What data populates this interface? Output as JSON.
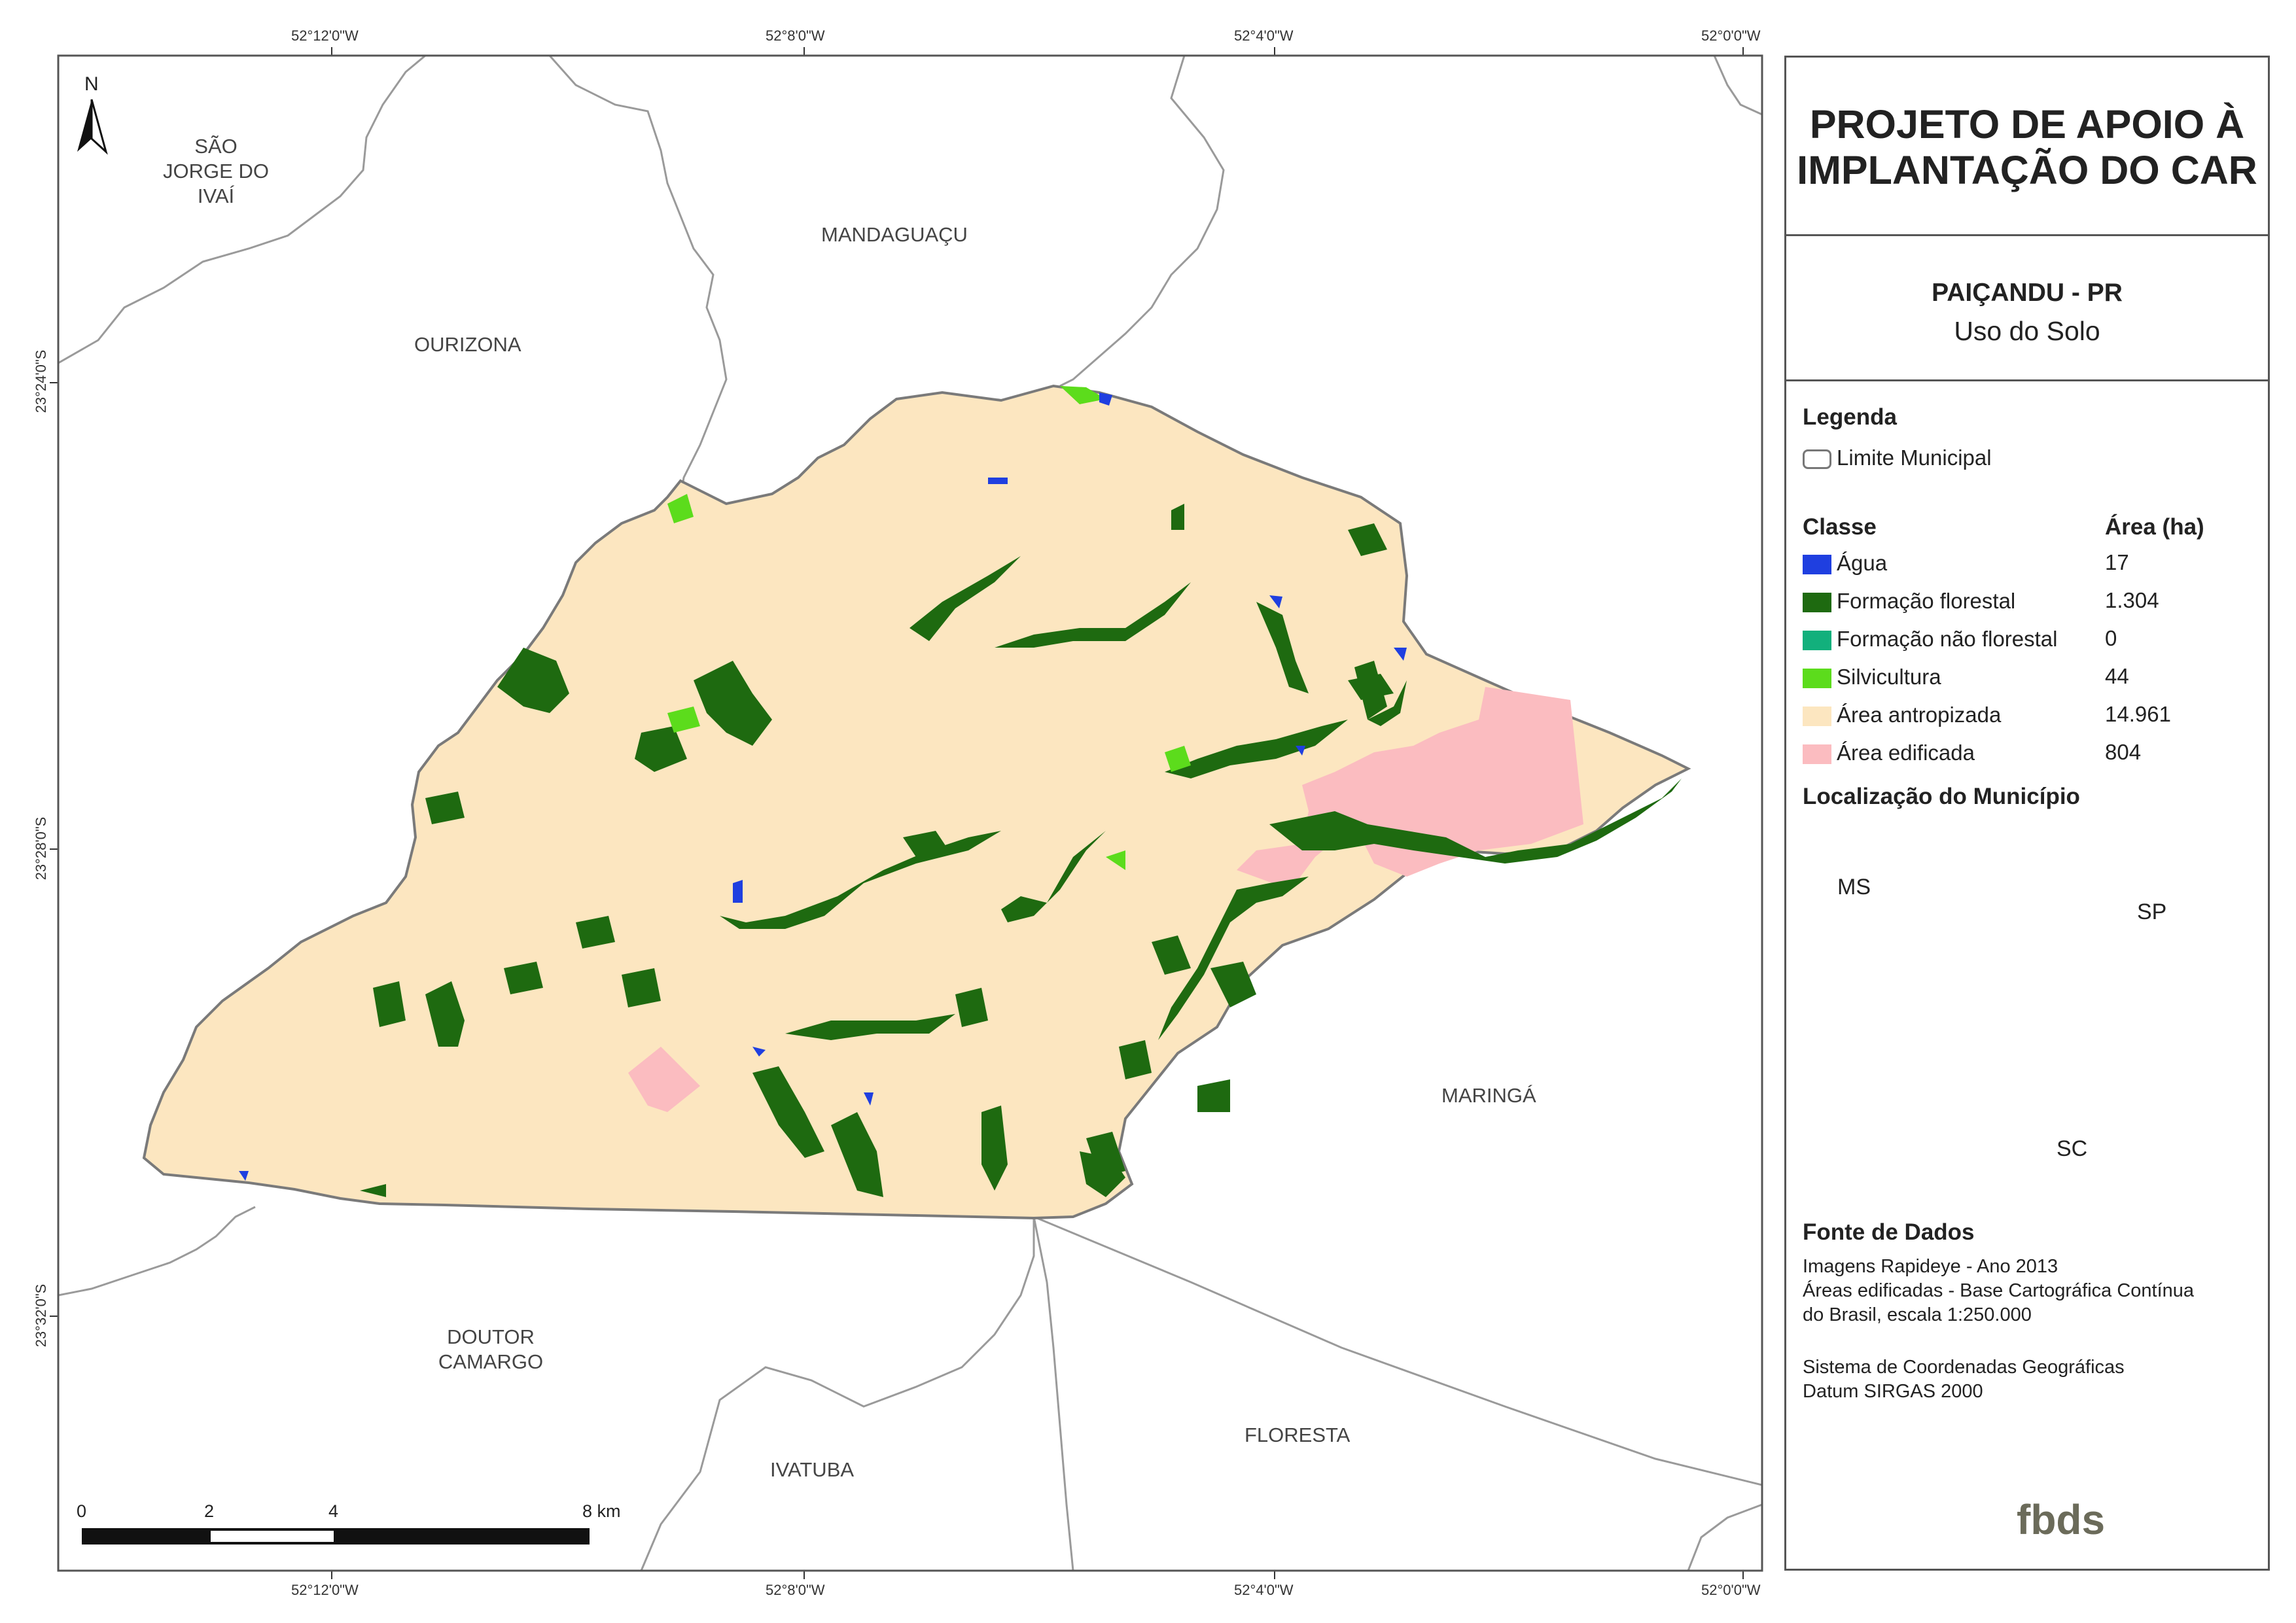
{
  "map": {
    "coords_top": [
      "52°12'0\"W",
      "52°8'0\"W",
      "52°4'0\"W",
      "52°0'0\"W"
    ],
    "coords_bottom": [
      "52°12'0\"W",
      "52°8'0\"W",
      "52°4'0\"W",
      "52°0'0\"W"
    ],
    "coords_left": [
      "23°24'0\"S",
      "23°28'0\"S",
      "23°32'0\"S"
    ],
    "north_label": "N",
    "municipalities": {
      "sao_jorge": [
        "SÃO",
        "JORGE DO",
        "IVAÍ"
      ],
      "mandaguacu": "MANDAGUAÇU",
      "ourizona": "OURIZONA",
      "maringa": "MARINGÁ",
      "doutor_camargo": [
        "DOUTOR",
        "CAMARGO"
      ],
      "ivatuba": "IVATUBA",
      "floresta": "FLORESTA"
    },
    "scale": {
      "labels": [
        "0",
        "2",
        "4",
        "8 km"
      ]
    },
    "colors": {
      "agua": "#1f3fe0",
      "formacao_florestal": "#1e6a10",
      "formacao_nao_florestal": "#12b07c",
      "silvicultura": "#5cdc1c",
      "area_antropizada": "#fce6c0",
      "area_edificada": "#fbbcc0"
    }
  },
  "panel": {
    "title": [
      "PROJETO DE APOIO À",
      "IMPLANTAÇÃO DO CAR"
    ],
    "municipio": "PAIÇANDU - PR",
    "tema": "Uso do Solo",
    "legenda_title": "Legenda",
    "limite_label": "Limite Municipal",
    "classe_header": "Classe",
    "area_header": "Área (ha)",
    "classes": [
      {
        "label": "Água",
        "area": "17",
        "color": "#1f3fe0"
      },
      {
        "label": "Formação florestal",
        "area": "1.304",
        "color": "#1e6a10"
      },
      {
        "label": "Formação não florestal",
        "area": "0",
        "color": "#12b07c"
      },
      {
        "label": "Silvicultura",
        "area": "44",
        "color": "#5cdc1c"
      },
      {
        "label": "Área antropizada",
        "area": "14.961",
        "color": "#fce6c0"
      },
      {
        "label": "Área edificada",
        "area": "804",
        "color": "#fbbcc0"
      }
    ],
    "localizacao_title": "Localização do Município",
    "inset_labels": {
      "ms": "MS",
      "sp": "SP",
      "sc": "SC"
    },
    "fonte_title": "Fonte de Dados",
    "fonte_lines": [
      "Imagens Rapideye - Ano 2013",
      "Áreas edificadas - Base Cartográfica Contínua",
      "do Brasil, escala 1:250.000"
    ],
    "sistema_lines": [
      "Sistema de Coordenadas Geográficas",
      "Datum SIRGAS 2000"
    ],
    "logo_text": "fbds"
  }
}
